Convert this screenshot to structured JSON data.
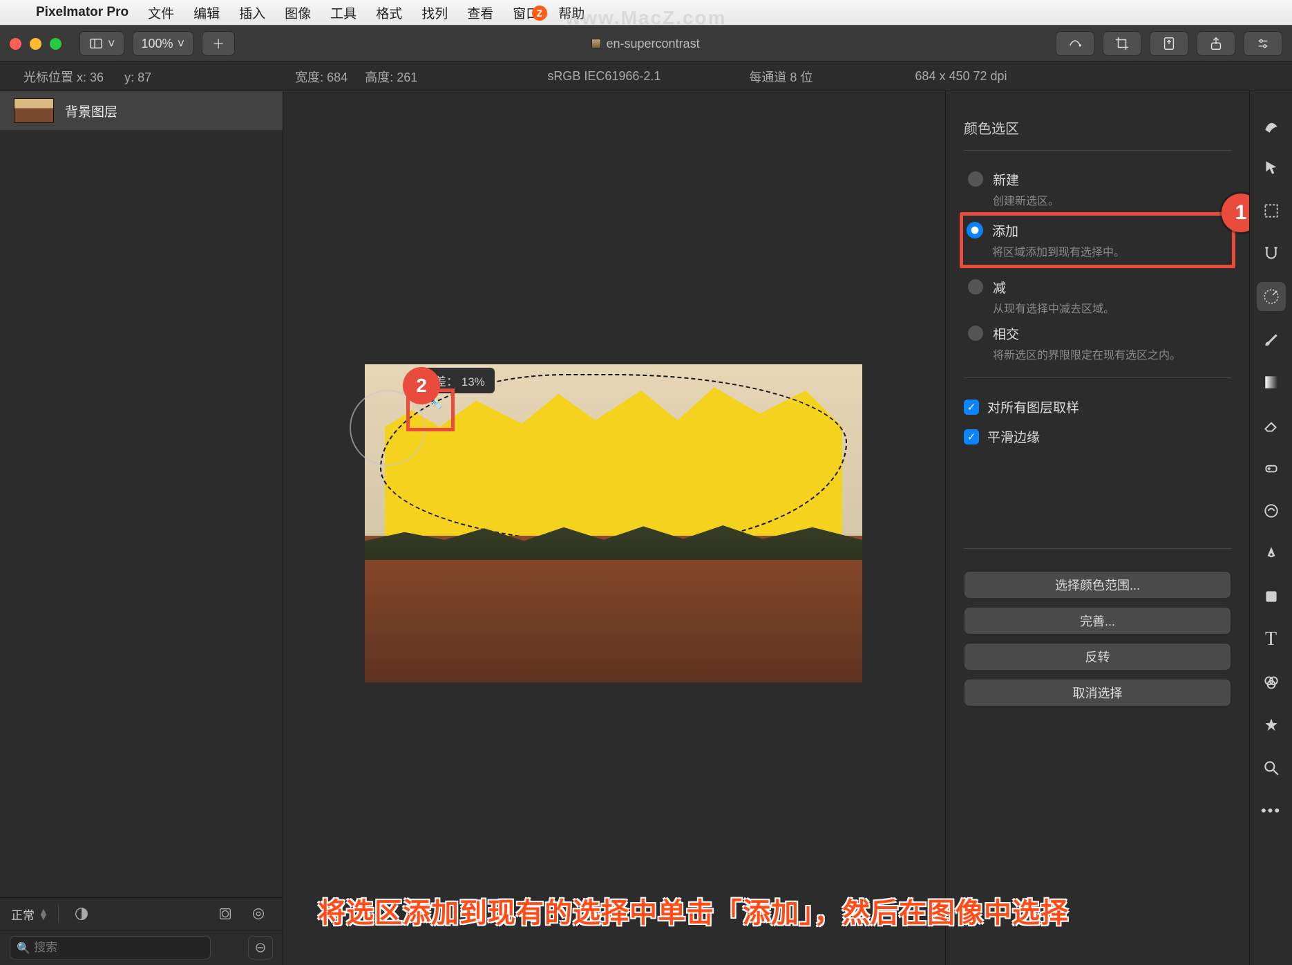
{
  "menubar": {
    "items": [
      "文件",
      "编辑",
      "插入",
      "图像",
      "工具",
      "格式",
      "找列",
      "查看",
      "窗口",
      "帮助"
    ],
    "appname": "Pixelmator Pro",
    "watermark": "www.MacZ.com"
  },
  "toolbar": {
    "zoom": "100%",
    "title": "en-supercontrast"
  },
  "infobar": {
    "cursor_label": "光标位置 x:",
    "cursor_x": "36",
    "cursor_y_label": "y:",
    "cursor_y": "87",
    "width_label": "宽度:",
    "width": "684",
    "height_label": "高度:",
    "height": "261",
    "colorspace": "sRGB IEC61966-2.1",
    "channel": "每通道 8 位",
    "dpi": "684 x 450 72 dpi"
  },
  "layers": {
    "row_label": "背景图层",
    "blend_mode": "正常",
    "search_placeholder": "搜索"
  },
  "canvas": {
    "tooltip_label": "公差：",
    "tooltip_value": "13%",
    "callout1": "1",
    "callout2": "2",
    "caption": "将选区添加到现有的选择中单击「添加」，然后在图像中选择"
  },
  "rpanel": {
    "title": "颜色选区",
    "opts": [
      {
        "t": "新建",
        "d": "创建新选区。"
      },
      {
        "t": "添加",
        "d": "将区域添加到现有选择中。"
      },
      {
        "t": "减",
        "d": "从现有选择中减去区域。"
      },
      {
        "t": "相交",
        "d": "将新选区的界限限定在现有选区之内。"
      }
    ],
    "chk_sample": "对所有图层取样",
    "chk_smooth": "平滑边缘",
    "btn_color": "选择颜色范围...",
    "btn_refine": "完善...",
    "btn_invert": "反转",
    "btn_deselect": "取消选择"
  },
  "vtools": [
    "brush-style",
    "pointer",
    "marquee",
    "magnet",
    "eyedropper",
    "paintbrush",
    "gradient",
    "eraser",
    "heal",
    "warp",
    "pen",
    "shape",
    "type",
    "color-sliders",
    "sparkle",
    "zoom",
    "more"
  ]
}
